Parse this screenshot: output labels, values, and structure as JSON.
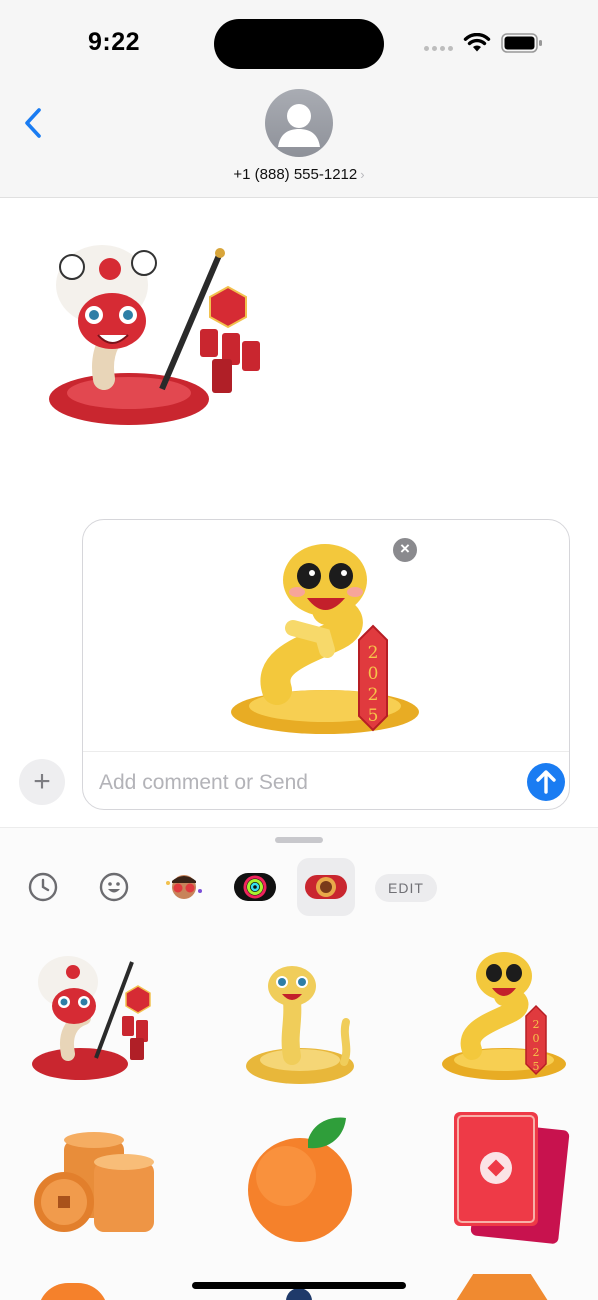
{
  "status_bar": {
    "time": "9:22"
  },
  "header": {
    "contact": "+1 (888) 555-1212",
    "contact_chevron": "›"
  },
  "compose": {
    "placeholder": "Add comment or Send",
    "remove": "×",
    "plus": "+"
  },
  "drawer": {
    "tabs": [
      "recents-icon",
      "emoji-icon",
      "memoji-sticker-icon",
      "activity-rings-sticker-icon",
      "lunar-new-year-sticker-icon"
    ],
    "selected_tab": "lunar-new-year-sticker-icon",
    "edit_label": "EDIT",
    "stickers": [
      "lion-dance-snake",
      "golden-snake",
      "snake-2025",
      "gold-coins",
      "mandarin-orange",
      "red-envelope"
    ]
  },
  "sticker_year": [
    "2",
    "0",
    "2",
    "5"
  ],
  "colors": {
    "accent": "#1a7cf2",
    "snake_gold": "#f3c83c",
    "snake_red": "#d62b34"
  }
}
